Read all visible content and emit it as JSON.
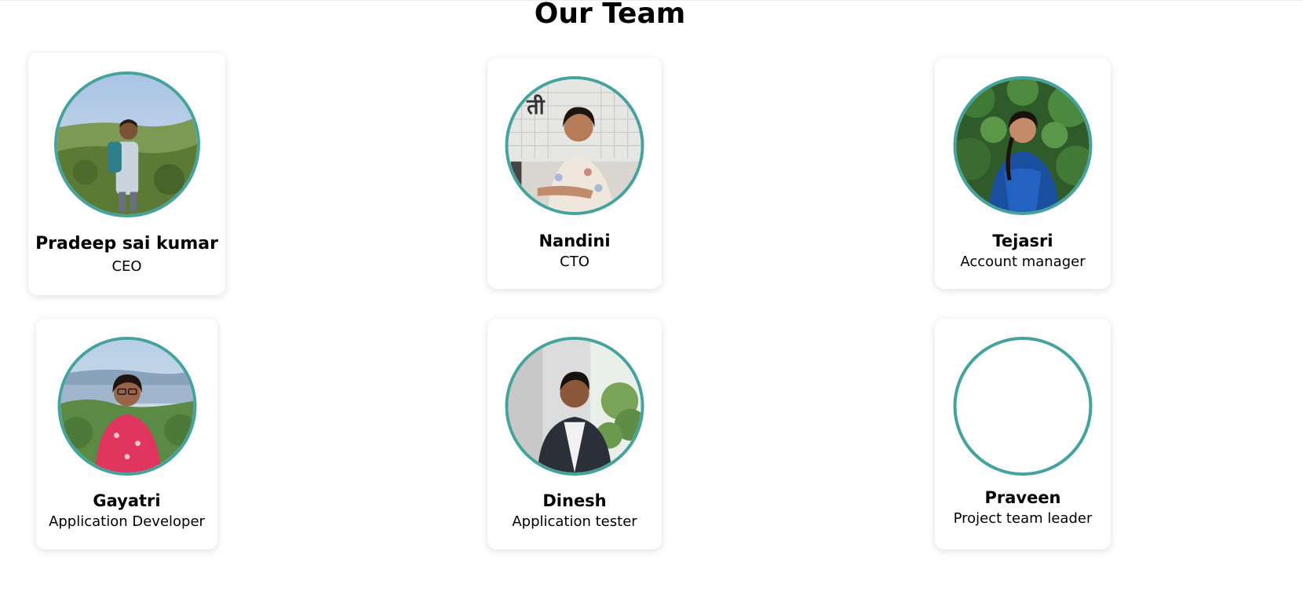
{
  "page": {
    "title": "Our Team"
  },
  "colors": {
    "avatar_border": "#46a29c",
    "card_background": "#ffffff"
  },
  "team": [
    {
      "name": "Pradeep sai kumar",
      "role": "CEO",
      "photo": "man-outdoor-hillside"
    },
    {
      "name": "Nandini",
      "role": "CTO",
      "photo": "woman-seated-cafe"
    },
    {
      "name": "Tejasri",
      "role": "Account manager",
      "photo": "woman-blue-dress-greenery"
    },
    {
      "name": "Gayatri",
      "role": "Application Developer",
      "photo": "woman-pink-top-seaside"
    },
    {
      "name": "Dinesh",
      "role": "Application tester",
      "photo": "man-dark-jacket-window"
    },
    {
      "name": "Praveen",
      "role": "Project team leader",
      "photo": ""
    }
  ]
}
